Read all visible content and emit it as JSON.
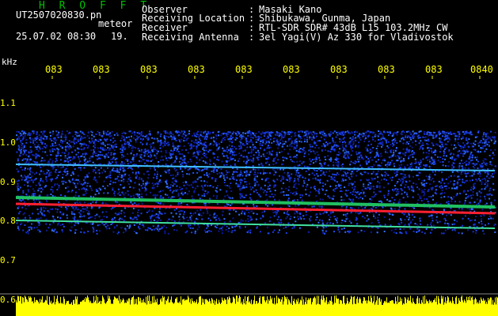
{
  "header": {
    "app_name": "H R O F F T",
    "filename": "UT2507020830.pn",
    "event_type": "meteor",
    "datetime": "25.07.02 08:30",
    "count": "19.",
    "fields": [
      {
        "key": "Observer",
        "value": "Masaki Kano"
      },
      {
        "key": "Receiving Location",
        "value": "Shibukawa, Gunma, Japan"
      },
      {
        "key": "Receiver",
        "value": "RTL-SDR SDR# 43dB L15 103.2MHz CW"
      },
      {
        "key": "Receiving Antenna",
        "value": "3el Yagi(V) Az 330 for Vladivostok"
      }
    ]
  },
  "spectrogram": {
    "unit_label": "kHz",
    "time_ticks": [
      "083",
      "083",
      "083",
      "083",
      "083",
      "083",
      "083",
      "083",
      "083",
      "0840"
    ],
    "freq_labels": [
      "1.1",
      "1.0",
      "0.9",
      "0.8",
      "0.7",
      "0.6"
    ],
    "colors": {
      "background": "#000000",
      "noise": "#1a2fd0",
      "band": "#ff2030",
      "label": "#ffff00",
      "amplitude": "#ffff00"
    }
  }
}
